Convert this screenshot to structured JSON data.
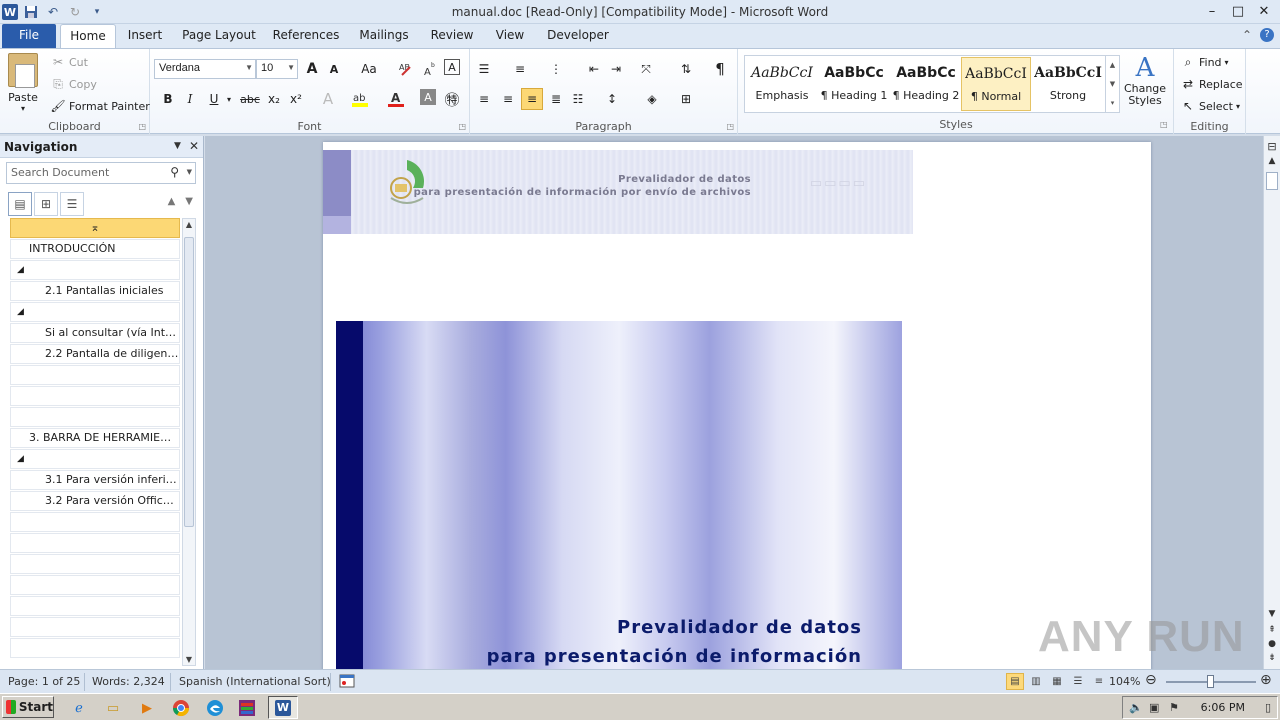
{
  "window": {
    "title": "manual.doc [Read-Only] [Compatibility Mode]  -  Microsoft Word",
    "app_letter": "W",
    "controls": [
      "–",
      "□",
      "✕"
    ]
  },
  "tabs": [
    "File",
    "Home",
    "Insert",
    "Page Layout",
    "References",
    "Mailings",
    "Review",
    "View",
    "Developer"
  ],
  "ribbon": {
    "clipboard": {
      "label": "Clipboard",
      "paste": "Paste",
      "cut": "Cut",
      "copy": "Copy",
      "format_painter": "Format Painter"
    },
    "font": {
      "label": "Font",
      "font_name": "Verdana",
      "font_size": "10",
      "grow": "A",
      "shrink": "A",
      "change_case": "Aa",
      "bold": "B",
      "italic": "I",
      "underline": "U",
      "strikethrough": "abc",
      "subscript": "x₂",
      "superscript": "x²",
      "font_color": "A",
      "char_shading": "A"
    },
    "paragraph": {
      "label": "Paragraph",
      "show_marks": "¶"
    },
    "styles": {
      "label": "Styles",
      "items": [
        {
          "sample": "AaBbCcI",
          "name": "Emphasis"
        },
        {
          "sample": "AaBbCc",
          "name": "¶ Heading 1"
        },
        {
          "sample": "AaBbCc",
          "name": "¶ Heading 2"
        },
        {
          "sample": "AaBbCcI",
          "name": "¶ Normal"
        },
        {
          "sample": "AaBbCcI",
          "name": "Strong"
        }
      ],
      "change_styles": "Change Styles"
    },
    "editing": {
      "label": "Editing",
      "find": "Find",
      "replace": "Replace",
      "select": "Select"
    }
  },
  "navigation": {
    "title": "Navigation",
    "search_placeholder": "Search Document",
    "items": [
      {
        "text": "⌅",
        "level": "sel"
      },
      {
        "text": "INTRODUCCIÓN",
        "level": "l1"
      },
      {
        "text": "◢",
        "level": "col"
      },
      {
        "text": "2.1 Pantallas iniciales",
        "level": "l2"
      },
      {
        "text": "◢",
        "level": "col"
      },
      {
        "text": "Si al consultar (vía Inter...",
        "level": "l2"
      },
      {
        "text": "2.2 Pantalla de diligenc...",
        "level": "l2"
      },
      {
        "text": "",
        "level": "l1"
      },
      {
        "text": "",
        "level": "l1"
      },
      {
        "text": "",
        "level": "l1"
      },
      {
        "text": "3. BARRA DE HERRAMIENT...",
        "level": "l1"
      },
      {
        "text": "◢",
        "level": "col"
      },
      {
        "text": "3.1 Para versión inferio...",
        "level": "l2"
      },
      {
        "text": "3.2 Para versión Office ...",
        "level": "l2"
      },
      {
        "text": "",
        "level": "l1"
      },
      {
        "text": "",
        "level": "l1"
      },
      {
        "text": "",
        "level": "l1"
      },
      {
        "text": "",
        "level": "l1"
      },
      {
        "text": "",
        "level": "l1"
      },
      {
        "text": "",
        "level": "l1"
      },
      {
        "text": "",
        "level": "l1"
      }
    ]
  },
  "document": {
    "banner_line1": "Prevalidador de datos",
    "banner_line2": "para presentación de información por envío de archivos",
    "cover_line1": "Prevalidador de datos",
    "cover_line2": "para presentación de información"
  },
  "statusbar": {
    "page": "Page: 1 of 25",
    "words": "Words: 2,324",
    "language": "Spanish (International Sort)",
    "zoom": "104%"
  },
  "taskbar": {
    "start": "Start",
    "clock": "6:06 PM"
  },
  "watermark": "ANY RUN"
}
